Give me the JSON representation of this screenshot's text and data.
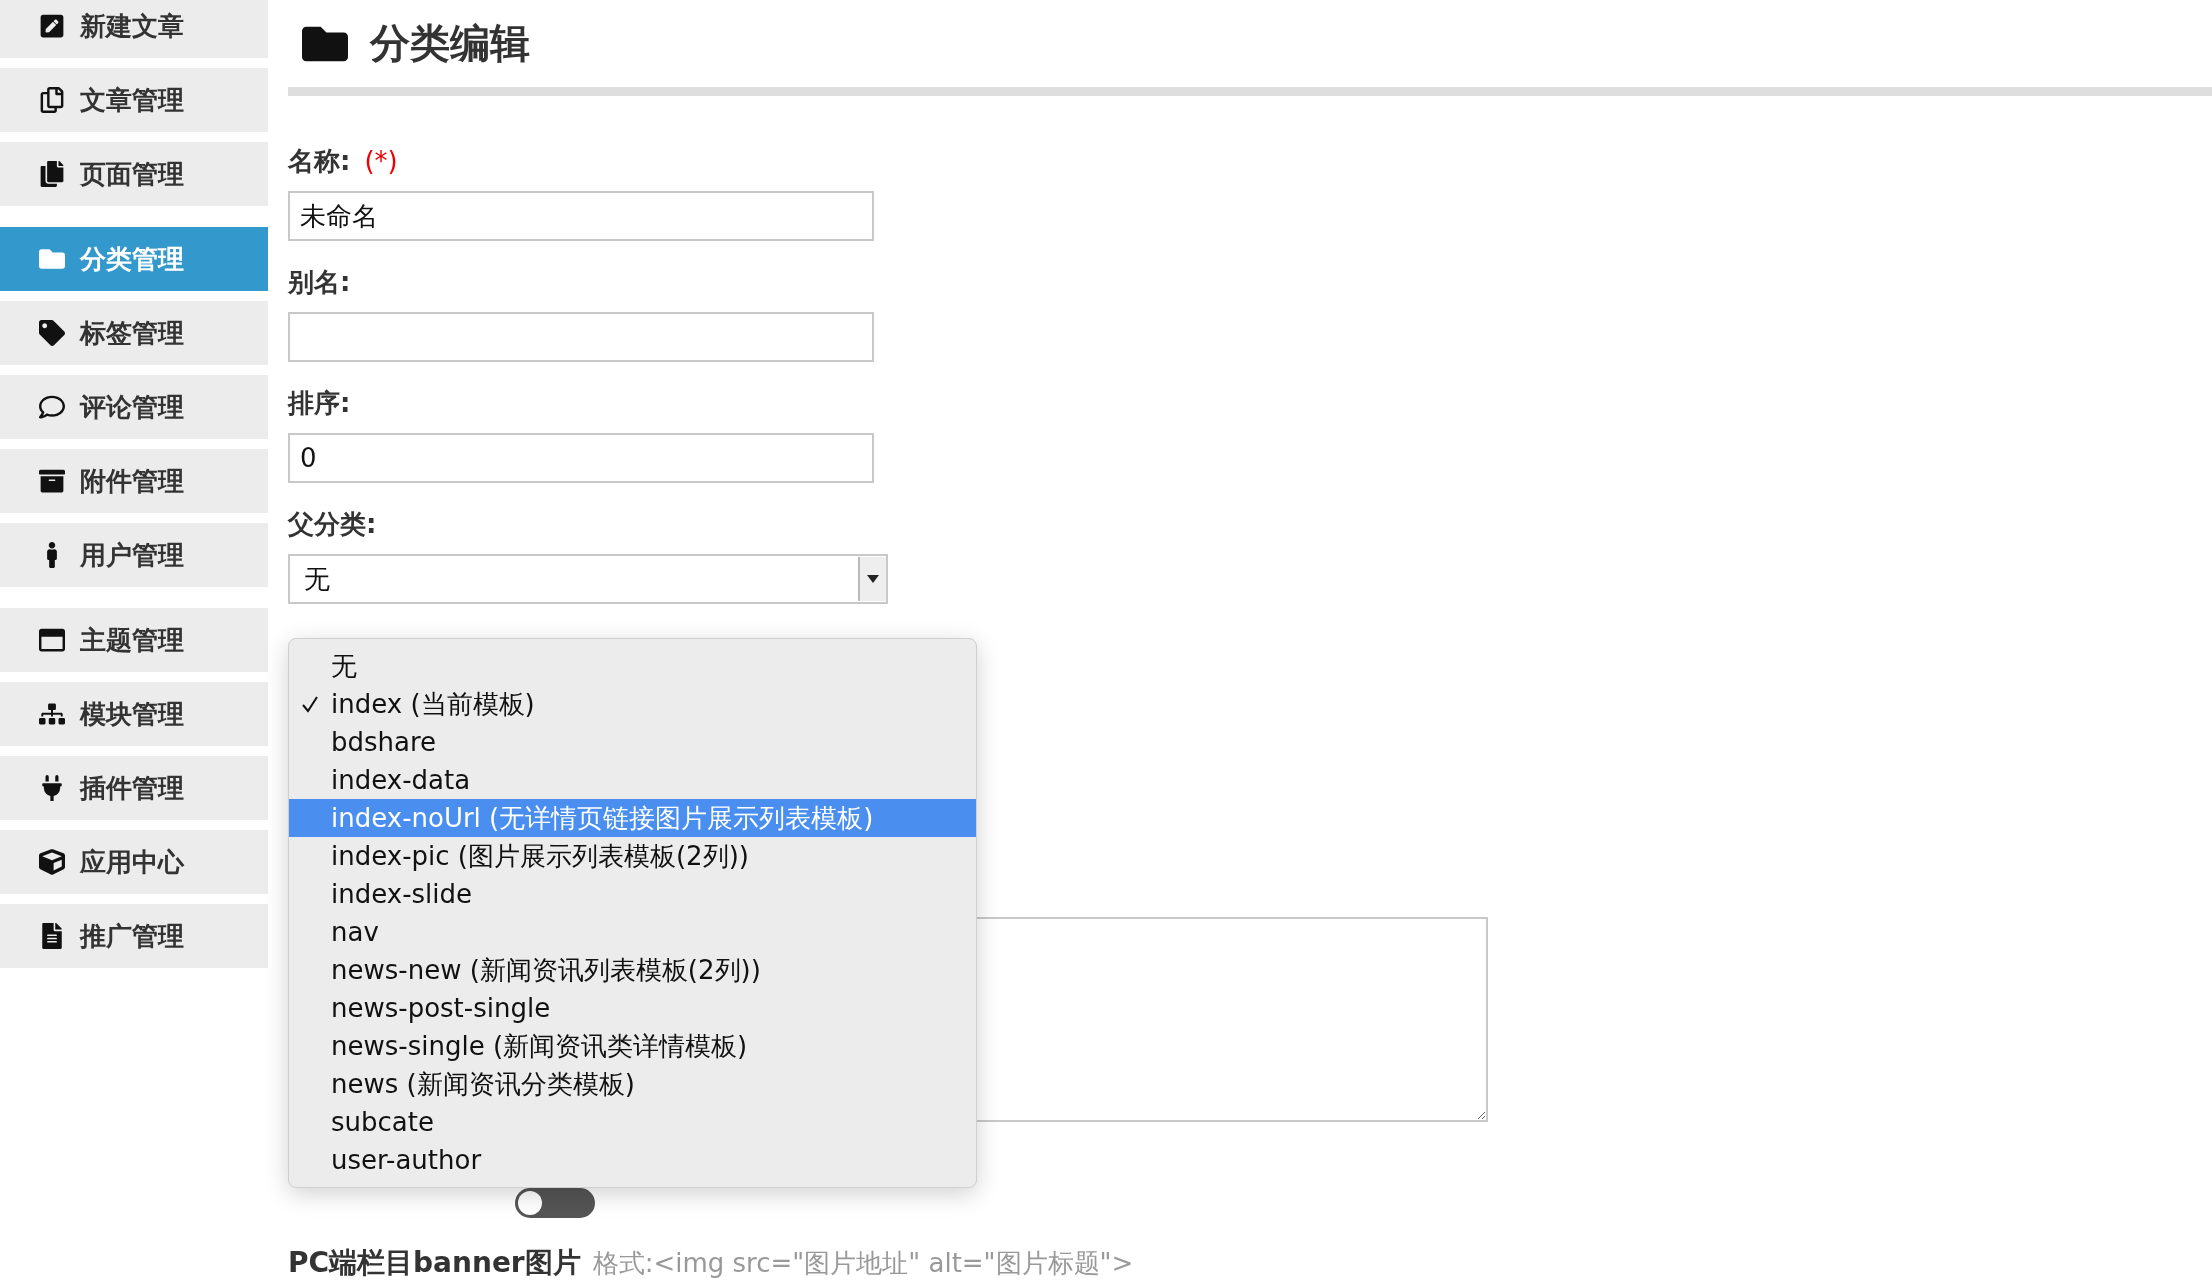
{
  "sidebar": {
    "sections": [
      {
        "items": [
          {
            "label": "新建文章",
            "selected": false
          },
          {
            "label": "文章管理",
            "selected": false
          },
          {
            "label": "页面管理",
            "selected": false
          }
        ]
      },
      {
        "items": [
          {
            "label": "分类管理",
            "selected": true
          },
          {
            "label": "标签管理",
            "selected": false
          },
          {
            "label": "评论管理",
            "selected": false
          },
          {
            "label": "附件管理",
            "selected": false
          },
          {
            "label": "用户管理",
            "selected": false
          }
        ]
      },
      {
        "items": [
          {
            "label": "主题管理",
            "selected": false
          },
          {
            "label": "模块管理",
            "selected": false
          },
          {
            "label": "插件管理",
            "selected": false
          },
          {
            "label": "应用中心",
            "selected": false
          },
          {
            "label": "推广管理",
            "selected": false
          }
        ]
      }
    ]
  },
  "page": {
    "title": "分类编辑"
  },
  "form": {
    "fields": [
      {
        "kind": "text",
        "label": "名称:",
        "required_mark": "(*)",
        "value": "未命名"
      },
      {
        "kind": "text",
        "label": "别名:"
      },
      {
        "kind": "text",
        "label": "排序:",
        "value": "0"
      },
      {
        "kind": "select",
        "label": "父分类:",
        "value": "无"
      }
    ]
  },
  "template_menu": {
    "options": [
      {
        "label": "无",
        "checked": false,
        "selected": false
      },
      {
        "label": "index (当前模板)",
        "checked": true,
        "selected": false
      },
      {
        "label": "bdshare",
        "checked": false,
        "selected": false
      },
      {
        "label": "index-data",
        "checked": false,
        "selected": false
      },
      {
        "label": "index-noUrl (无详情页链接图片展示列表模板)",
        "checked": false,
        "selected": true
      },
      {
        "label": "index-pic (图片展示列表模板(2列))",
        "checked": false,
        "selected": false
      },
      {
        "label": "index-slide",
        "checked": false,
        "selected": false
      },
      {
        "label": "nav",
        "checked": false,
        "selected": false
      },
      {
        "label": "news-new (新闻资讯列表模板(2列))",
        "checked": false,
        "selected": false
      },
      {
        "label": "news-post-single",
        "checked": false,
        "selected": false
      },
      {
        "label": "news-single (新闻资讯类详情模板)",
        "checked": false,
        "selected": false
      },
      {
        "label": "news (新闻资讯分类模板)",
        "checked": false,
        "selected": false
      },
      {
        "label": "subcate",
        "checked": false,
        "selected": false
      },
      {
        "label": "user-author",
        "checked": false,
        "selected": false
      }
    ]
  },
  "nav_switch": {
    "on": false
  },
  "banner": {
    "label": "PC端栏目banner图片",
    "hint": "格式:<img src=\"图片地址\" alt=\"图片标题\">"
  }
}
